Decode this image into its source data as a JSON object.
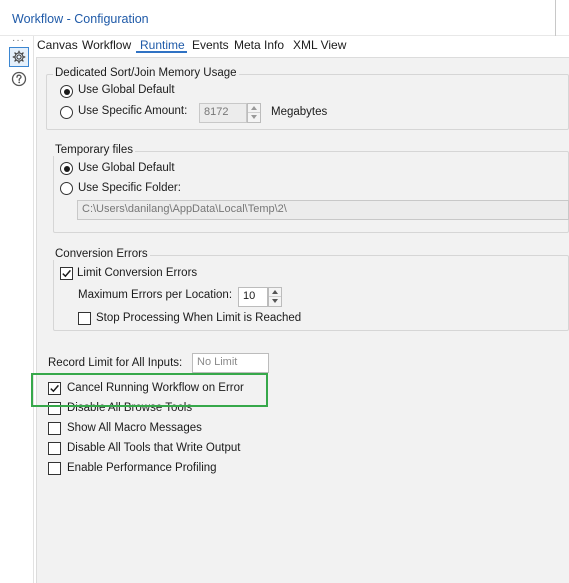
{
  "window": {
    "title": "Workflow - Configuration"
  },
  "tabs": [
    "Canvas",
    "Workflow",
    "Runtime",
    "Events",
    "Meta Info",
    "XML View"
  ],
  "active_tab": "Runtime",
  "sidebar": {
    "icons": [
      "gear-icon",
      "help-icon"
    ]
  },
  "memory": {
    "group_title": "Dedicated Sort/Join Memory Usage",
    "option_global": "Use Global Default",
    "option_specific": "Use Specific Amount:",
    "amount_value": "8172",
    "unit": "Megabytes",
    "selected": "global"
  },
  "temp_files": {
    "group_title": "Temporary files",
    "option_global": "Use Global Default",
    "option_specific": "Use Specific Folder:",
    "folder_path": "C:\\Users\\danilang\\AppData\\Local\\Temp\\2\\",
    "selected": "global"
  },
  "conversion_errors": {
    "group_title": "Conversion Errors",
    "limit_label": "Limit Conversion Errors",
    "limit_checked": true,
    "max_errors_label": "Maximum Errors per Location:",
    "max_errors_value": "10",
    "stop_label": "Stop Processing When Limit is Reached",
    "stop_checked": false
  },
  "record_limit": {
    "label": "Record Limit for All Inputs:",
    "placeholder": "No Limit"
  },
  "options": [
    {
      "label": "Cancel Running Workflow on Error",
      "checked": true
    },
    {
      "label": "Disable All Browse Tools",
      "checked": false
    },
    {
      "label": "Show All Macro Messages",
      "checked": false
    },
    {
      "label": "Disable All Tools that Write Output",
      "checked": false
    },
    {
      "label": "Enable Performance Profiling",
      "checked": false
    }
  ],
  "colors": {
    "accent": "#1f5aa8",
    "highlight": "#36a84a",
    "panel_bg": "#f2f2f2"
  }
}
